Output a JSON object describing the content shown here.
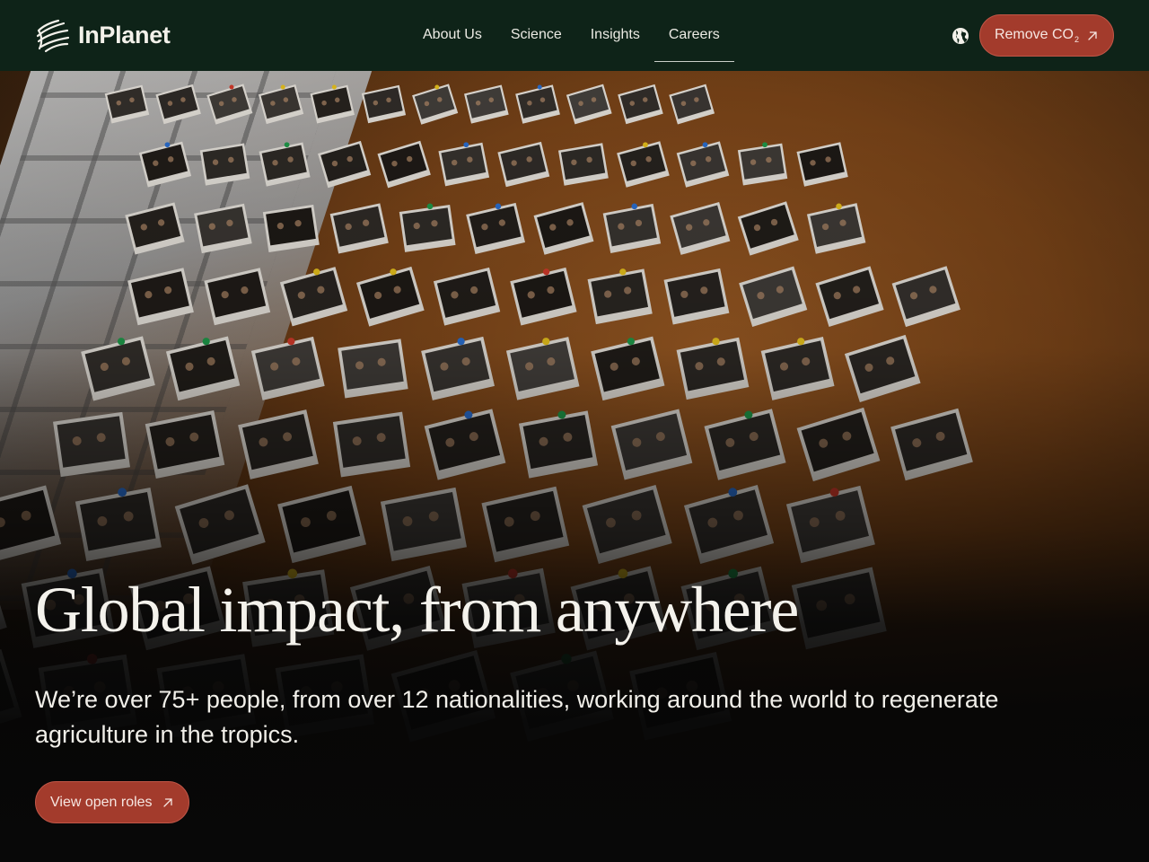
{
  "header": {
    "logo_text": "InPlanet",
    "nav": [
      {
        "label": "About Us",
        "active": false
      },
      {
        "label": "Science",
        "active": false
      },
      {
        "label": "Insights",
        "active": false
      },
      {
        "label": "Careers",
        "active": true
      }
    ],
    "language_icon": "globe-icon",
    "cta": {
      "label": "Remove CO",
      "subscript": "2",
      "icon": "arrow-up-right-icon"
    }
  },
  "hero": {
    "title": "Global impact, from anywhere",
    "subtitle": "We’re over 75+ people, from over 12 nationalities, working around the world to regenerate agriculture in the tropics.",
    "button": {
      "label": "View open roles",
      "icon": "arrow-up-right-icon"
    },
    "background": "photo of corkboard covered in pinned polaroid team photos"
  },
  "colors": {
    "header_bg": "#0e2318",
    "accent": "#a33b2c",
    "accent_border": "#c15647",
    "text": "#f4f2ec"
  }
}
